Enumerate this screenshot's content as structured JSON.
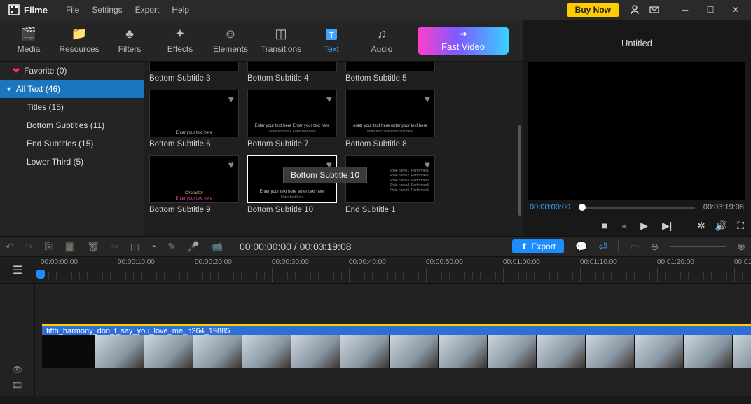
{
  "app": {
    "name": "Filme"
  },
  "menu": {
    "file": "File",
    "settings": "Settings",
    "export": "Export",
    "help": "Help"
  },
  "titlebar": {
    "buy": "Buy Now"
  },
  "tabs": {
    "media": "Media",
    "resources": "Resources",
    "filters": "Filters",
    "effects": "Effects",
    "elements": "Elements",
    "transitions": "Transitions",
    "text": "Text",
    "audio": "Audio",
    "fastvideo": "Fast Video"
  },
  "sidebar": {
    "favorite": "Favorite (0)",
    "alltext": "All Text (46)",
    "subs": {
      "titles": "Titles (15)",
      "bottom": "Bottom Subtitles (11)",
      "end": "End Subtitles (15)",
      "lower": "Lower Third (5)"
    }
  },
  "grid": {
    "r0": {
      "a": "Bottom Subtitle 3",
      "b": "Bottom Subtitle 4",
      "c": "Bottom Subtitle 5"
    },
    "r1": {
      "a": "Bottom Subtitle 6",
      "b": "Bottom Subtitle 7",
      "c": "Bottom Subtitle 8"
    },
    "r2": {
      "a": "Bottom Subtitle 9",
      "b": "Bottom Subtitle 10",
      "c": "End Subtitle 1"
    },
    "tooltip": "Bottom Subtitle 10"
  },
  "preview": {
    "title": "Untitled",
    "current": "00:00:00:00",
    "total": "00:03:19:08"
  },
  "toolbar": {
    "time": "00:00:00:00 / 00:03:19:08",
    "export": "Export"
  },
  "ruler": {
    "t0": "00:00:00:00",
    "t1": "00:00:10:00",
    "t2": "00:00:20:00",
    "t3": "00:00:30:00",
    "t4": "00:00:40:00",
    "t5": "00:00:50:00",
    "t6": "00:01:00:00",
    "t7": "00:01:10:00",
    "t8": "00:01:20:00",
    "t9": "00:01"
  },
  "clip": {
    "name": "fifth_harmony_don_t_say_you_love_me_h264_19885"
  }
}
